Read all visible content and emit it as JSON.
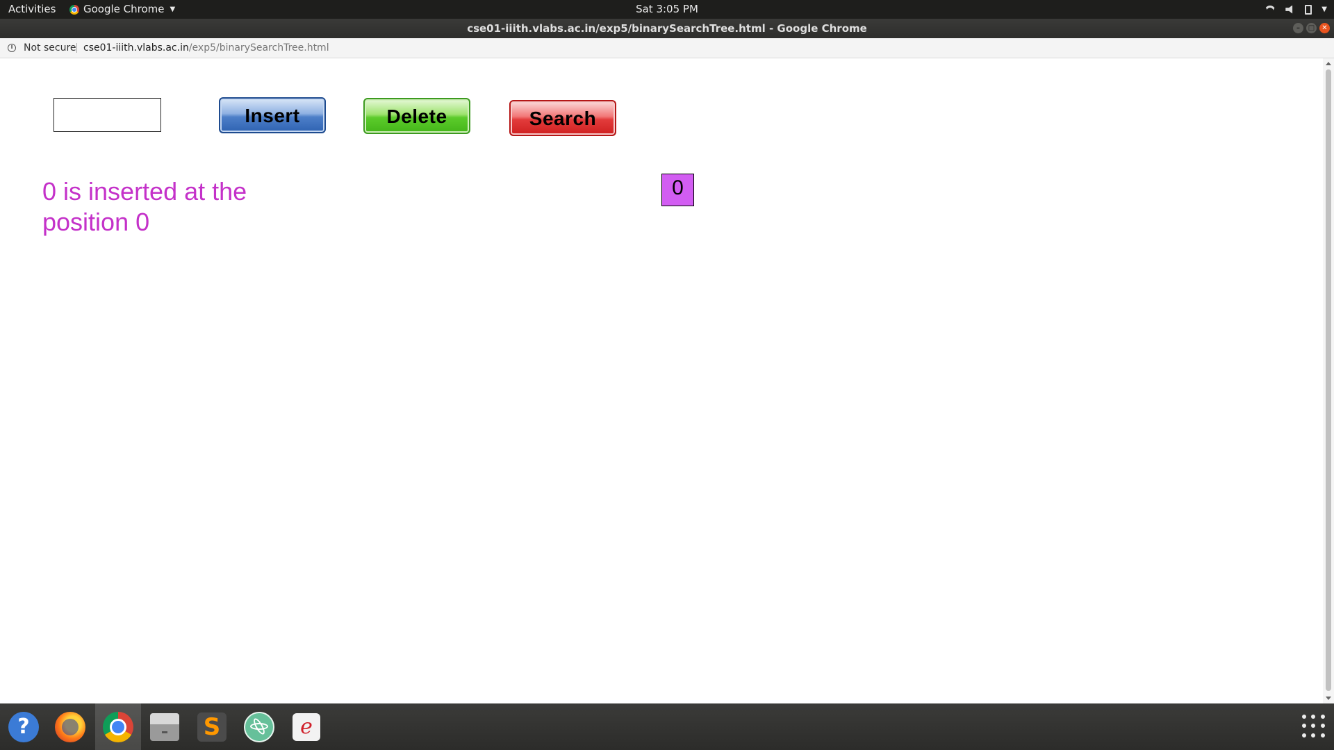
{
  "topbar": {
    "activities": "Activities",
    "app_name": "Google Chrome",
    "clock": "Sat  3:05 PM"
  },
  "titlebar": {
    "title": "cse01-iiith.vlabs.ac.in/exp5/binarySearchTree.html - Google Chrome"
  },
  "addressbar": {
    "security": "Not secure",
    "host": "cse01-iiith.vlabs.ac.in",
    "path": "/exp5/binarySearchTree.html"
  },
  "controls": {
    "input_value": "",
    "insert_label": "Insert",
    "delete_label": "Delete",
    "search_label": "Search"
  },
  "message": "0 is inserted at the position 0",
  "tree": {
    "root_value": "0",
    "node_color": "#d25df2"
  },
  "colors": {
    "message_text": "#c431c9",
    "insert_button": "#4d7fc8",
    "delete_button": "#5ccb2b",
    "search_button": "#e23b3b"
  },
  "dock": {
    "apps": [
      "help-icon",
      "firefox-icon",
      "chrome-icon",
      "files-icon",
      "sublime-text-icon",
      "atom-icon",
      "text-editor-icon"
    ],
    "help_glyph": "?",
    "sublime_glyph": "S",
    "editor_glyph": "e"
  }
}
